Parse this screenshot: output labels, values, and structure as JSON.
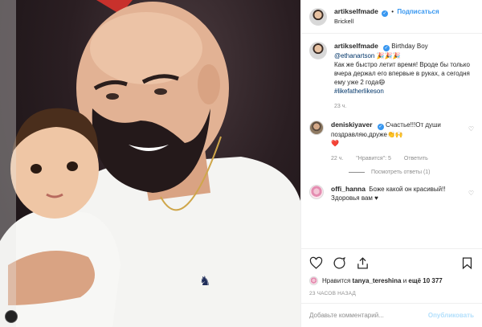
{
  "header": {
    "username": "artikselfmade",
    "verified_icon": "verified-badge",
    "separator": "•",
    "follow_label": "Подписаться",
    "location": "Brickell"
  },
  "caption": {
    "username": "artikselfmade",
    "line1": "Birthday Boy",
    "mention": "@ethanartson",
    "emoji": "🎉🎉🎉",
    "text": "Как же быстро летит время! Вроде бы только вчера держал его впервые в руках, а сегодня ему уже 2 года😄",
    "hashtag": "#likefatherlikeson",
    "time": "23 ч."
  },
  "comments": [
    {
      "username": "deniskiyaver",
      "text": "Счастье!!!От души поздравляю,друже👏🙌",
      "heart": "❤️",
      "time": "22 ч.",
      "likes": "\"Нравится\": 5",
      "reply": "Ответить",
      "view_replies": "Посмотреть ответы (1)"
    },
    {
      "username": "offi_hanna",
      "text": "Боже какой он красивый!! Здоровья вам ♥"
    }
  ],
  "likes": {
    "prefix": "Нравится",
    "user": "tanya_tereshina",
    "middle": "и",
    "rest": "ещё 10 377"
  },
  "time_ago": "23 ЧАСОВ НАЗАД",
  "comment_input": {
    "placeholder": "Добавьте комментарий...",
    "publish_label": "Опубликовать"
  },
  "colors": {
    "accent": "#3897f0",
    "publish_disabled": "#b2dffc",
    "like_heart": "#ed4956"
  }
}
